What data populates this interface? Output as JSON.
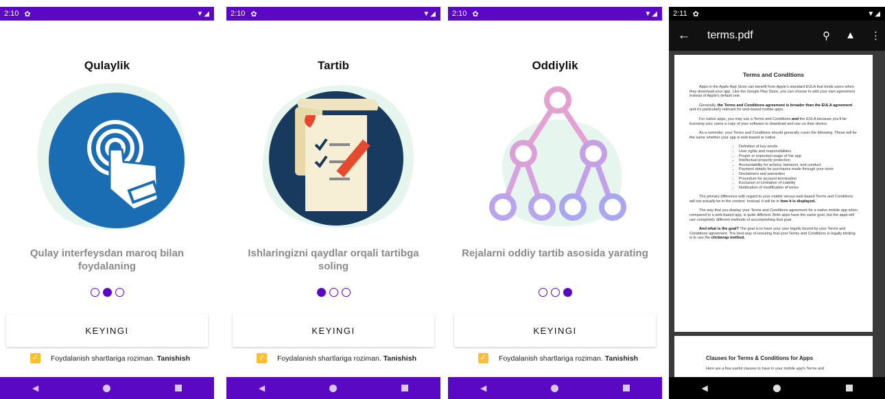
{
  "screens": [
    {
      "status_time": "2:10",
      "title": "Qulaylik",
      "subtitle": "Qulay interfeysdan maroq bilan foydalaning",
      "active_dot": 1,
      "button": "KEYINGI",
      "agree_text": "Foydalanish shartlariga roziman.",
      "agree_link": "Tanishish",
      "checkbox_checked": true,
      "illustration": "touch-hand-icon"
    },
    {
      "status_time": "2:10",
      "title": "Tartib",
      "subtitle": "Ishlaringizni qaydlar orqali tartibga soling",
      "active_dot": 0,
      "button": "KEYINGI",
      "agree_text": "Foydalanish shartlariga roziman.",
      "agree_link": "Tanishish",
      "checkbox_checked": true,
      "illustration": "checklist-scroll-icon"
    },
    {
      "status_time": "2:10",
      "title": "Oddiylik",
      "subtitle": "Rejalarni oddiy tartib asosida yarating",
      "active_dot": 2,
      "button": "KEYINGI",
      "agree_text": "Foydalanish shartlariga roziman.",
      "agree_link": "Tanishish",
      "checkbox_checked": true,
      "illustration": "tree-diagram-icon"
    }
  ],
  "pdf": {
    "status_time": "2:11",
    "file_name": "terms.pdf",
    "doc_title": "Terms and Conditions",
    "p1": "Apps in the Apple App Store can benefit from Apple's standard EULA that binds users when they download your app. Like the Google Play Store, you can choose to add your own agreement instead of Apple's default one.",
    "p2_a": "Generally,",
    "p2_b": "the Terms and Conditions agreement is broader than the EULA agreement",
    "p2_c": "and it's particularly relevant for web-based mobile apps.",
    "p3_a": "For native apps, you may use a Terms and Conditions",
    "p3_b": "and",
    "p3_c": "the EULA because you'll be licensing your users a copy of your software to download and use on their device.",
    "p4": "As a reminder, your Terms and Conditions should generally cover the following. These will be the same whether your app is web-based or native.",
    "bullets": [
      "Definition of key words",
      "User rights and responsibilities",
      "Proper or expected usage of the app",
      "Intellectual property protection",
      "Accountability for actions, behavior, and conduct",
      "Payment details for purchases made through your store",
      "Disclaimers and warranties",
      "Procedure for account termination",
      "Exclusion or Limitation of Liability",
      "Notification of modification of terms"
    ],
    "p5_a": "The primary difference with regard to your mobile versus web-based Terms and Conditions will not actually be in the content. Instead, it will be in",
    "p5_b": "how it is displayed.",
    "p6": "The way that you display your Terms and Conditions agreement for a native mobile app when compared to a web-based app, is quite different. Both apps have the same goal, but the apps will use completely different methods of accomplishing that goal.",
    "p7_a": "And what is the goal?",
    "p7_b": "The goal is to have your user legally bound by your Terms and Conditions agreement. The best way of ensuring that your Terms and Conditions is legally binding is to use the",
    "p7_c": "clickwrap method.",
    "page2_title": "Clauses for Terms & Conditions for Apps",
    "page2_text": "Here are a few useful clauses to have in your mobile app's Terms and"
  },
  "colors": {
    "primary": "#5b08c4",
    "checkbox": "#f9c22d",
    "subtitle": "#8a8a8a"
  }
}
